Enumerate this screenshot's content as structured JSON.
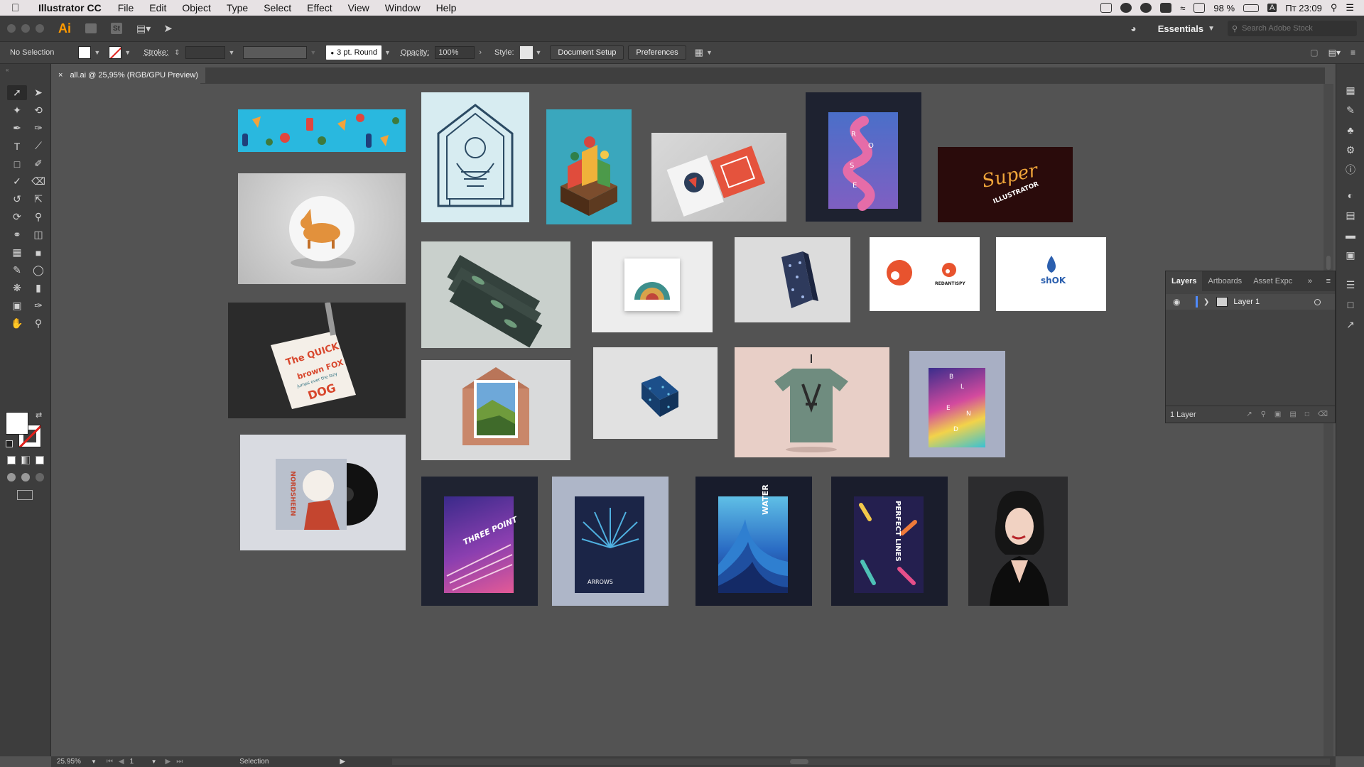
{
  "menubar": {
    "apple": "",
    "app_name": "Illustrator CC",
    "items": [
      "File",
      "Edit",
      "Object",
      "Type",
      "Select",
      "Effect",
      "View",
      "Window",
      "Help"
    ],
    "battery": "98 %",
    "input_source": "A",
    "clock": "Пт 23:09"
  },
  "appbar": {
    "logo": "Ai",
    "bridge_label": "St",
    "workspace": "Essentials",
    "stock_search_placeholder": "Search Adobe Stock"
  },
  "controlbar": {
    "selection": "No Selection",
    "stroke_label": "Stroke:",
    "brush": "3 pt. Round",
    "opacity_label": "Opacity:",
    "opacity_value": "100%",
    "style_label": "Style:",
    "document_setup": "Document Setup",
    "preferences": "Preferences"
  },
  "document": {
    "tab_title": "all.ai @ 25,95% (RGB/GPU Preview)",
    "close": "×"
  },
  "layers_panel": {
    "tabs": [
      "Layers",
      "Artboards",
      "Asset Expc"
    ],
    "layer_name": "Layer 1",
    "count": "1 Layer"
  },
  "statusbar": {
    "zoom": "25.95%",
    "page": "1",
    "tool": "Selection"
  },
  "artwork_text": {
    "rose_letters": [
      "R",
      "O",
      "S",
      "E"
    ],
    "super_1": "Super",
    "super_2": "ILLUSTRATOR",
    "redantispy": "REDANTISPY",
    "shok": "shOK",
    "quick_1": "The QUICK",
    "quick_2": "brown FOX",
    "quick_3": "jumps over the lazy",
    "quick_4": "DOG",
    "blend": [
      "B",
      "L",
      "E",
      "N",
      "D"
    ],
    "three_point": "THREE POINT",
    "arrows": "ARROWS",
    "water": "WATER",
    "perfect_lines": "PERFECT LINES",
    "album": "NORDSHEEN"
  },
  "colors": {
    "ai_orange": "#ff9a00",
    "canvas_bg": "#535353",
    "layer_color": "#4f8bff"
  }
}
